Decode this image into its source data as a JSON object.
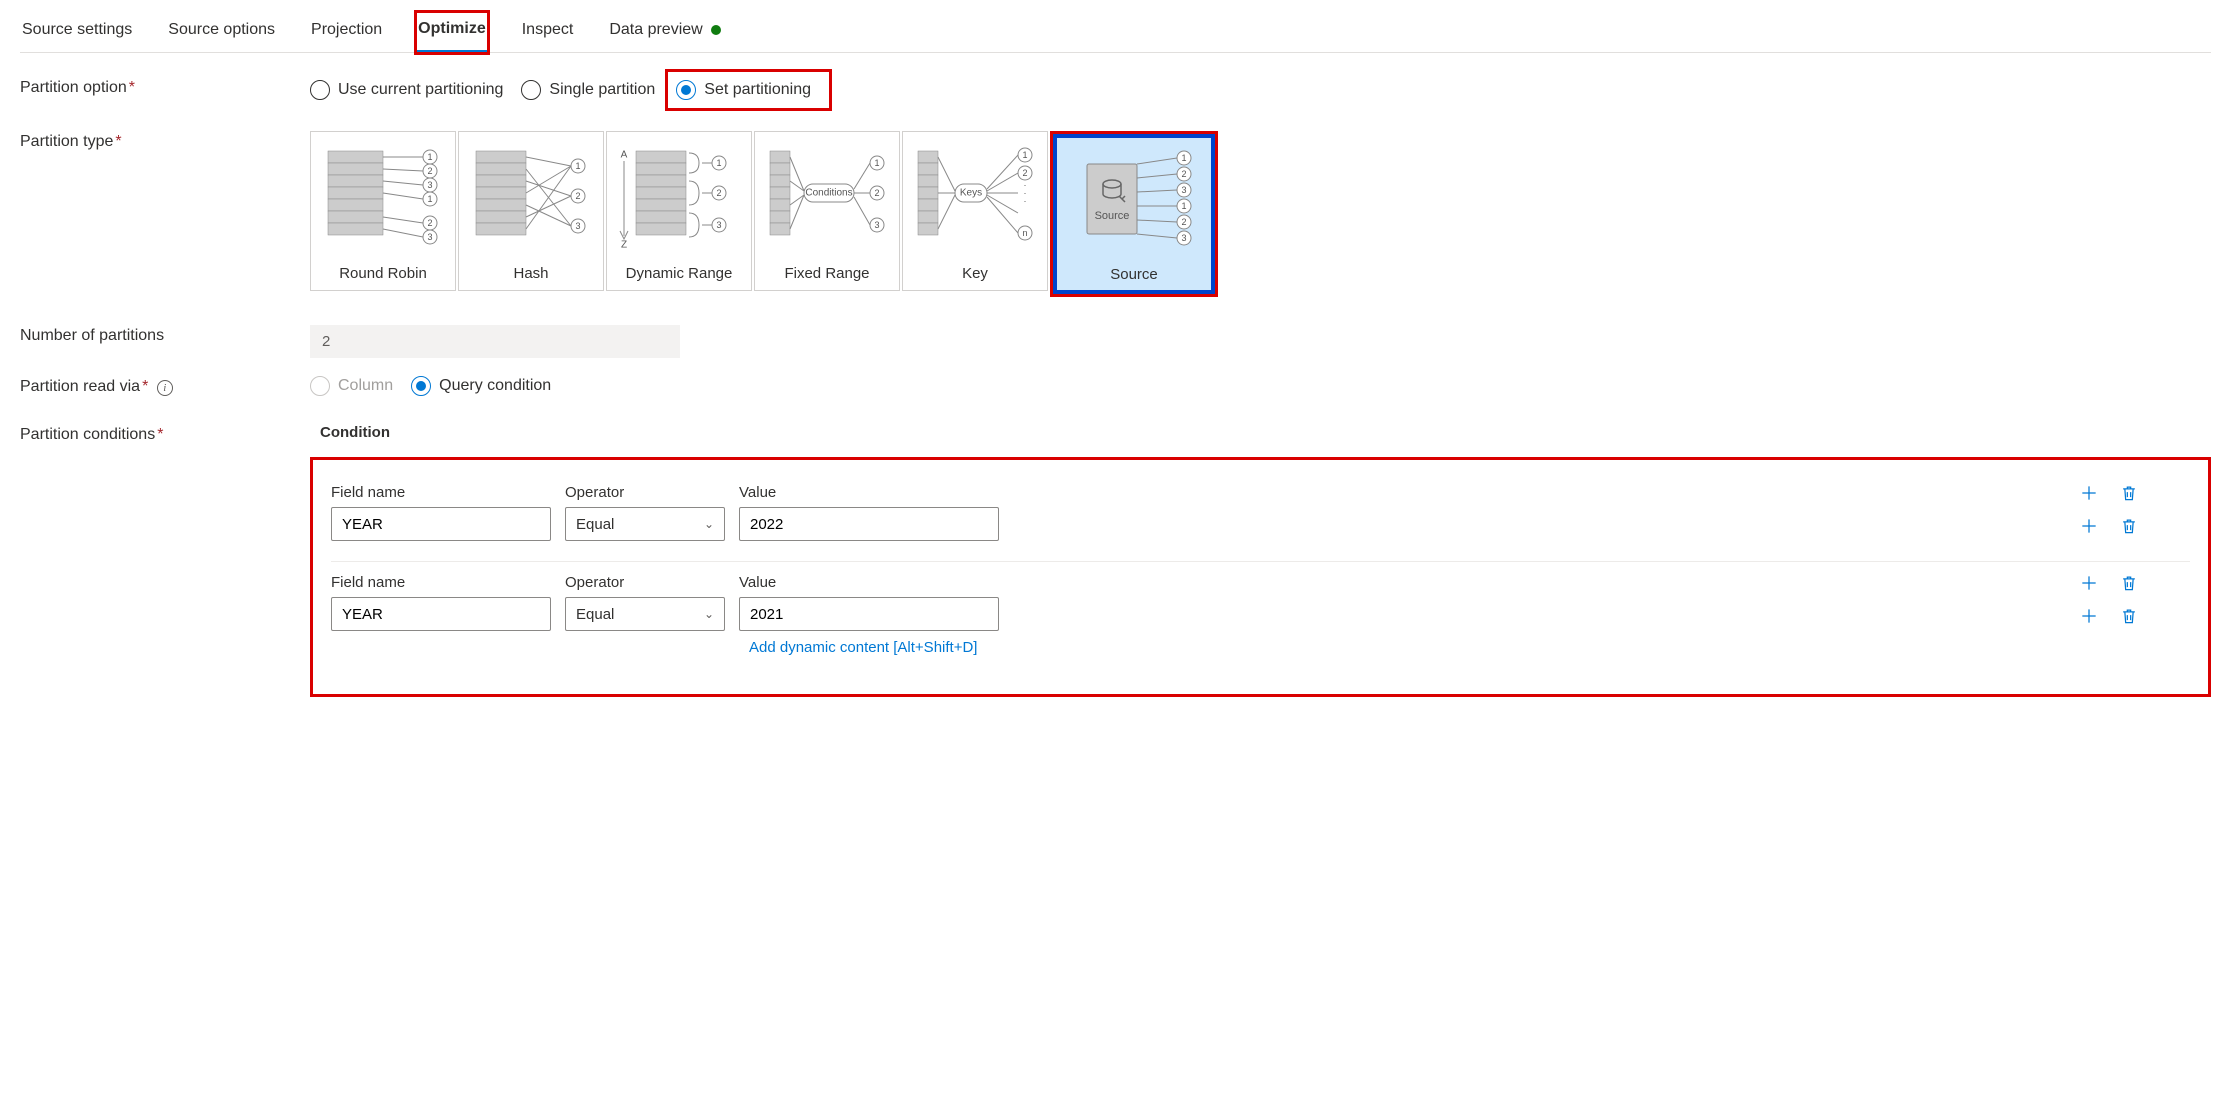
{
  "tabs": [
    {
      "label": "Source settings"
    },
    {
      "label": "Source options"
    },
    {
      "label": "Projection"
    },
    {
      "label": "Optimize",
      "active": true,
      "highlighted": true
    },
    {
      "label": "Inspect"
    },
    {
      "label": "Data preview",
      "status": true
    }
  ],
  "labels": {
    "partition_option": "Partition option",
    "partition_type": "Partition type",
    "num_partitions": "Number of partitions",
    "partition_read_via": "Partition read via",
    "partition_conditions": "Partition conditions",
    "condition_header": "Condition",
    "field_name": "Field name",
    "operator": "Operator",
    "value": "Value",
    "add_dynamic": "Add dynamic content [Alt+Shift+D]"
  },
  "partition_option": {
    "options": [
      {
        "label": "Use current partitioning",
        "checked": false
      },
      {
        "label": "Single partition",
        "checked": false
      },
      {
        "label": "Set partitioning",
        "checked": true,
        "highlighted": true
      }
    ]
  },
  "partition_types": [
    {
      "label": "Round Robin"
    },
    {
      "label": "Hash"
    },
    {
      "label": "Dynamic Range"
    },
    {
      "label": "Fixed Range"
    },
    {
      "label": "Key"
    },
    {
      "label": "Source",
      "selected": true,
      "highlighted": true
    }
  ],
  "num_partitions_value": "2",
  "partition_read_via": {
    "options": [
      {
        "label": "Column",
        "checked": false,
        "disabled": true
      },
      {
        "label": "Query condition",
        "checked": true
      }
    ]
  },
  "conditions": [
    {
      "field": "YEAR",
      "operator": "Equal",
      "value": "2022"
    },
    {
      "field": "YEAR",
      "operator": "Equal",
      "value": "2021",
      "show_dynamic": true
    }
  ]
}
